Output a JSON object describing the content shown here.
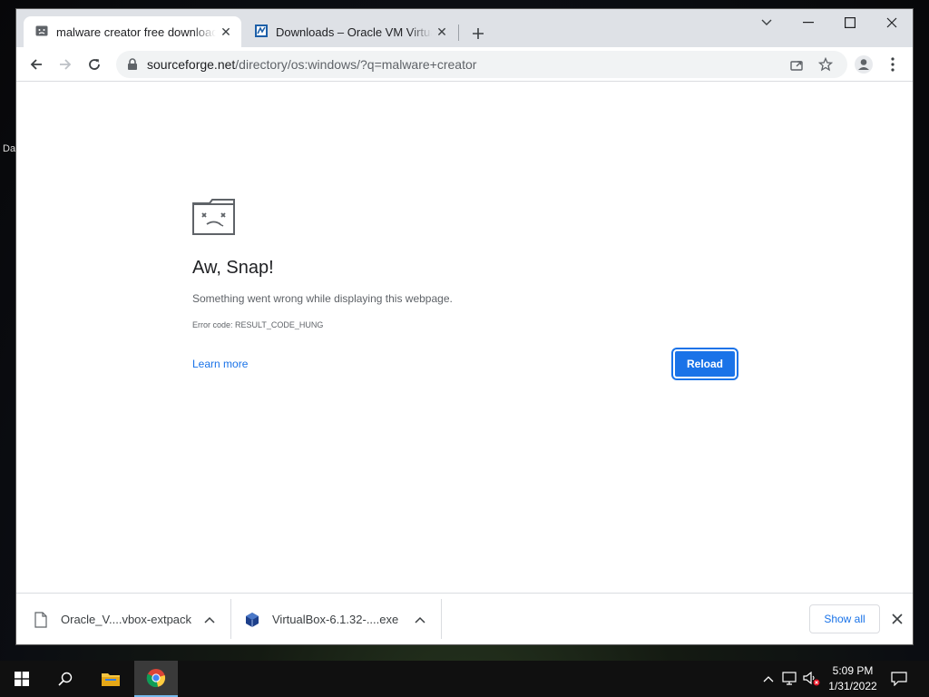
{
  "desktop": {
    "fragment_label": "Da"
  },
  "browser": {
    "tabs": [
      {
        "title": "malware creator free download - ",
        "active": true,
        "icon": "sad-page-icon"
      },
      {
        "title": "Downloads – Oracle VM VirtualBox",
        "active": false,
        "icon": "virtualbox-icon"
      }
    ],
    "address_bar": {
      "host": "sourceforge.net",
      "path": "/directory/os:windows/?q=malware+creator"
    }
  },
  "error_page": {
    "title": "Aw, Snap!",
    "message": "Something went wrong while displaying this webpage.",
    "error_code": "Error code: RESULT_CODE_HUNG",
    "learn_more": "Learn more",
    "reload": "Reload"
  },
  "download_shelf": {
    "items": [
      {
        "name": "Oracle_V....vbox-extpack",
        "icon": "file-icon"
      },
      {
        "name": "VirtualBox-6.1.32-....exe",
        "icon": "virtualbox-icon"
      }
    ],
    "show_all": "Show all"
  },
  "taskbar": {
    "time": "5:09 PM",
    "date": "1/31/2022"
  },
  "colors": {
    "accent": "#1a73e8",
    "titlebar": "#dee1e6",
    "taskbar": "#101010"
  }
}
